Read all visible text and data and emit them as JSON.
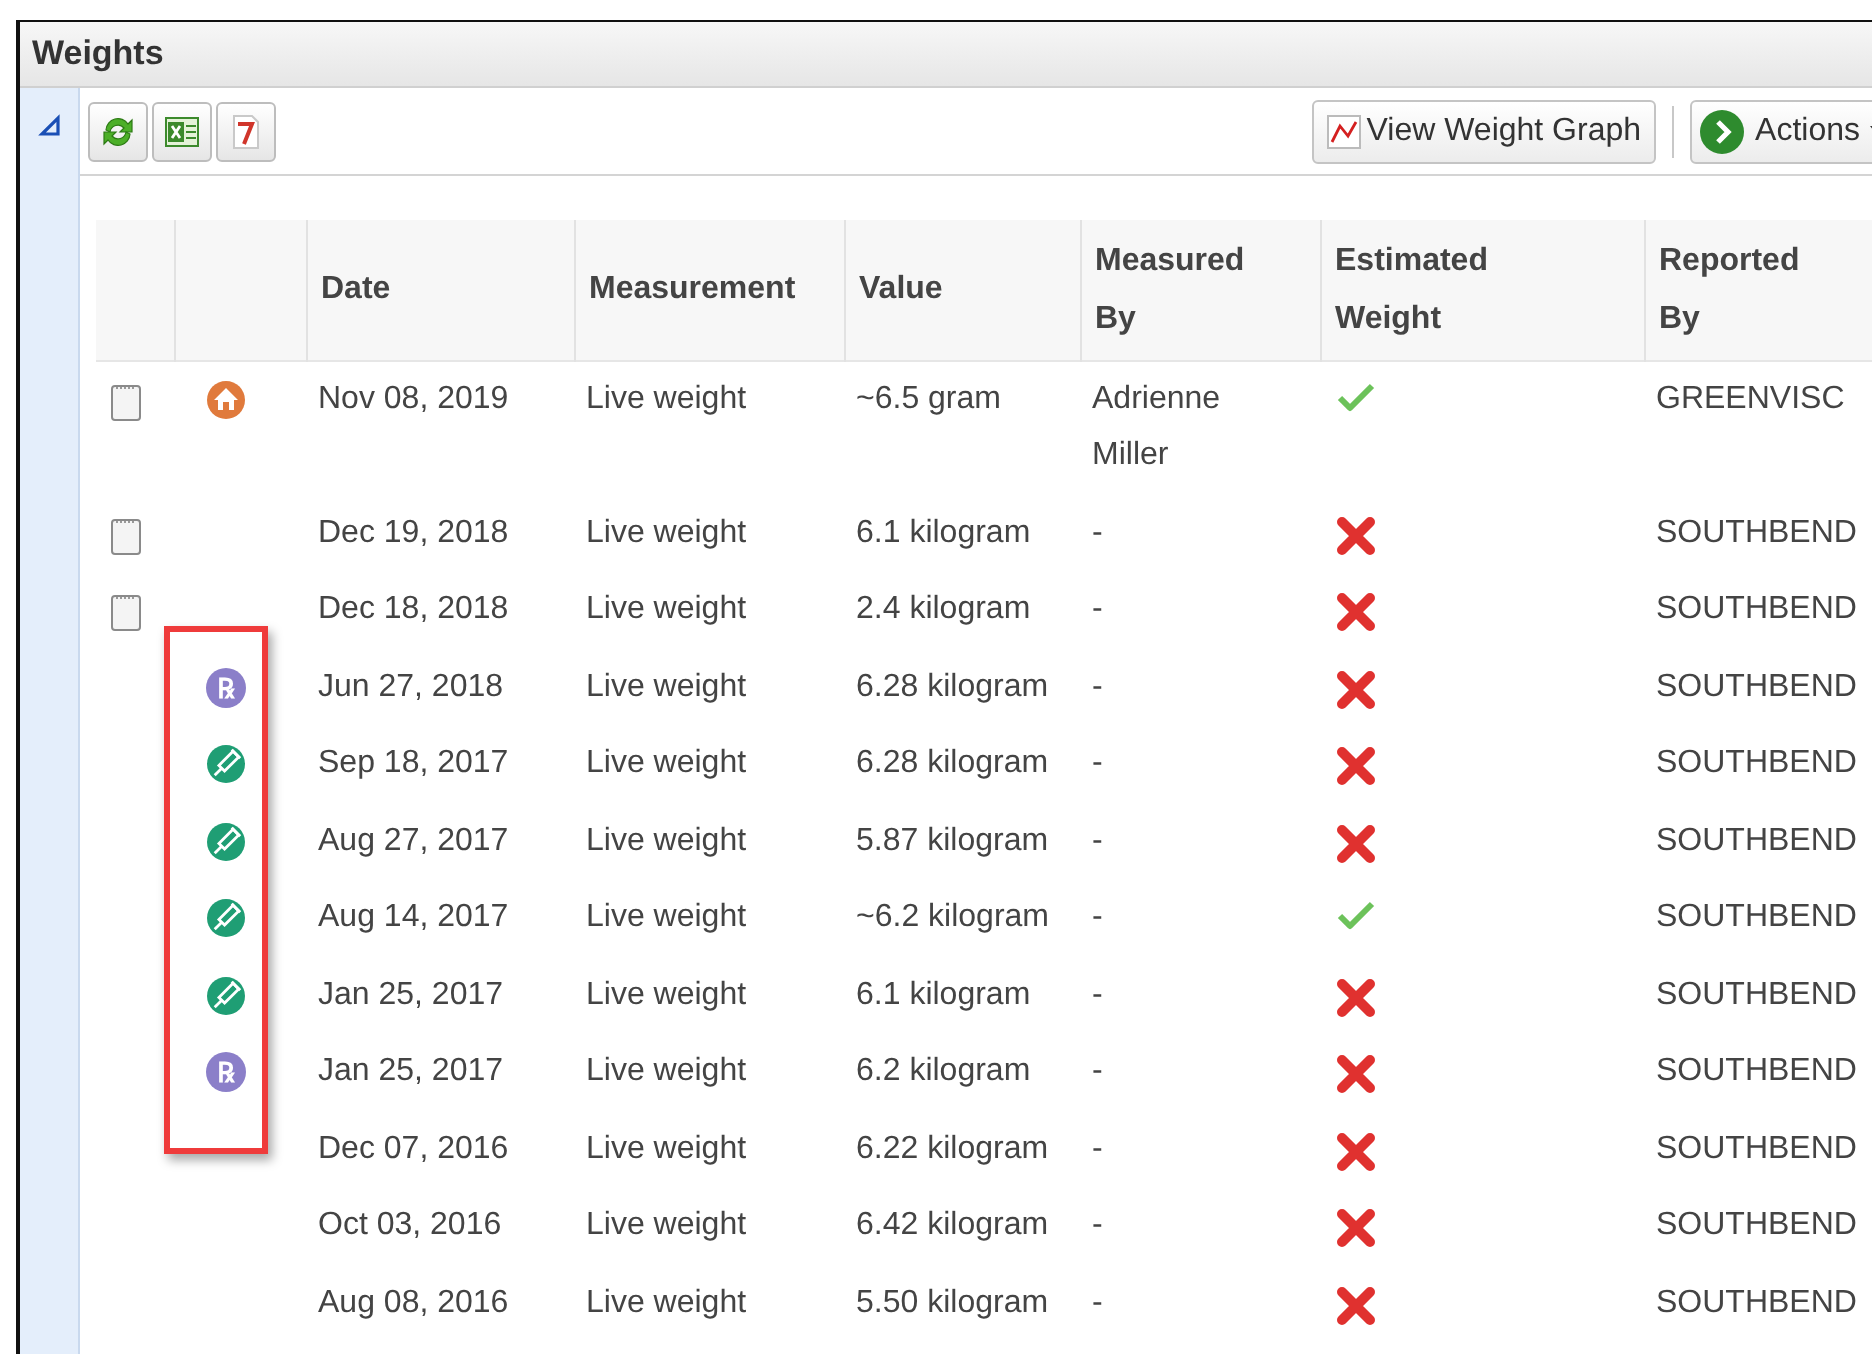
{
  "panel": {
    "title": "Weights",
    "expanded": true
  },
  "toolbar": {
    "tools": [
      {
        "kind": "refresh"
      },
      {
        "kind": "excel"
      },
      {
        "kind": "pdf"
      }
    ],
    "graph_button": "View Weight Graph",
    "actions_button": "Actions"
  },
  "table": {
    "columns": [
      "Date",
      "Measurement",
      "Value",
      "Measured By",
      "Estimated Weight",
      "Reported By"
    ],
    "rows": [
      {
        "note": true,
        "marker": {
          "kind": "home"
        },
        "highlighted": false,
        "date": "Nov 08, 2019",
        "measurement": "Live weight",
        "value": "~6.5 gram",
        "measured_by": "Adrienne Miller",
        "estimated": true,
        "reported_by": "GREENVISC"
      },
      {
        "note": true,
        "marker": {
          "kind": "none"
        },
        "highlighted": false,
        "date": "Dec 19, 2018",
        "measurement": "Live weight",
        "value": "6.1 kilogram",
        "measured_by": "-",
        "estimated": false,
        "reported_by": "SOUTHBEND"
      },
      {
        "note": true,
        "marker": {
          "kind": "none"
        },
        "highlighted": false,
        "date": "Dec 18, 2018",
        "measurement": "Live weight",
        "value": "2.4 kilogram",
        "measured_by": "-",
        "estimated": false,
        "reported_by": "SOUTHBEND"
      },
      {
        "note": false,
        "marker": {
          "kind": "rx",
          "glyph": "℞"
        },
        "highlighted": true,
        "date": "Jun 27, 2018",
        "measurement": "Live weight",
        "value": "6.28 kilogram",
        "measured_by": "-",
        "estimated": false,
        "reported_by": "SOUTHBEND"
      },
      {
        "note": false,
        "marker": {
          "kind": "syringe"
        },
        "highlighted": true,
        "date": "Sep 18, 2017",
        "measurement": "Live weight",
        "value": "6.28 kilogram",
        "measured_by": "-",
        "estimated": false,
        "reported_by": "SOUTHBEND"
      },
      {
        "note": false,
        "marker": {
          "kind": "syringe"
        },
        "highlighted": true,
        "date": "Aug 27, 2017",
        "measurement": "Live weight",
        "value": "5.87 kilogram",
        "measured_by": "-",
        "estimated": false,
        "reported_by": "SOUTHBEND"
      },
      {
        "note": false,
        "marker": {
          "kind": "syringe"
        },
        "highlighted": true,
        "date": "Aug 14, 2017",
        "measurement": "Live weight",
        "value": "~6.2 kilogram",
        "measured_by": "-",
        "estimated": true,
        "reported_by": "SOUTHBEND"
      },
      {
        "note": false,
        "marker": {
          "kind": "syringe"
        },
        "highlighted": true,
        "date": "Jan 25, 2017",
        "measurement": "Live weight",
        "value": "6.1 kilogram",
        "measured_by": "-",
        "estimated": false,
        "reported_by": "SOUTHBEND"
      },
      {
        "note": false,
        "marker": {
          "kind": "rx",
          "glyph": "℞"
        },
        "highlighted": true,
        "date": "Jan 25, 2017",
        "measurement": "Live weight",
        "value": "6.2 kilogram",
        "measured_by": "-",
        "estimated": false,
        "reported_by": "SOUTHBEND"
      },
      {
        "note": false,
        "marker": {
          "kind": "none"
        },
        "highlighted": false,
        "date": "Dec 07, 2016",
        "measurement": "Live weight",
        "value": "6.22 kilogram",
        "measured_by": "-",
        "estimated": false,
        "reported_by": "SOUTHBEND"
      },
      {
        "note": false,
        "marker": {
          "kind": "none"
        },
        "highlighted": false,
        "date": "Oct 03, 2016",
        "measurement": "Live weight",
        "value": "6.42 kilogram",
        "measured_by": "-",
        "estimated": false,
        "reported_by": "SOUTHBEND"
      },
      {
        "note": false,
        "marker": {
          "kind": "none"
        },
        "highlighted": false,
        "date": "Aug 08, 2016",
        "measurement": "Live weight",
        "value": "5.50 kilogram",
        "measured_by": "-",
        "estimated": false,
        "reported_by": "SOUTHBEND"
      }
    ]
  }
}
